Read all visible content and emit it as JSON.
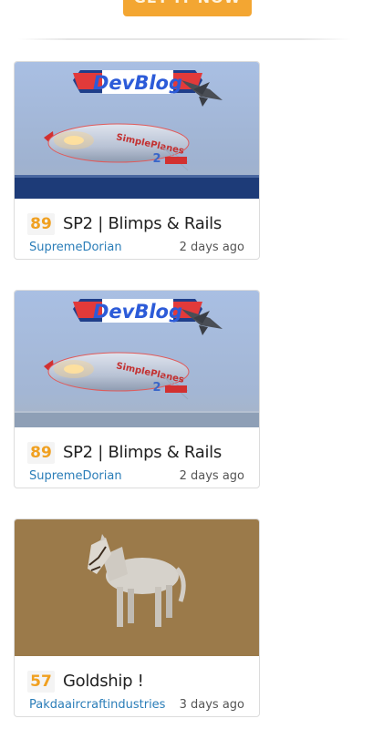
{
  "cta": {
    "label": "GET IT NOW"
  },
  "posts": [
    {
      "score": "89",
      "title": "SP2 | Blimps & Rails",
      "author": "SupremeDorian",
      "age": "2 days ago",
      "thumb": {
        "banner": "DevBlog",
        "blimp_text": "SimplePlanes",
        "blimp_number": "2"
      }
    },
    {
      "score": "89",
      "title": "SP2 | Blimps & Rails",
      "author": "SupremeDorian",
      "age": "2 days ago",
      "thumb": {
        "banner": "DevBlog",
        "blimp_text": "SimplePlanes",
        "blimp_number": "2"
      }
    },
    {
      "score": "57",
      "title": "Goldship !",
      "author": "Pakdaaircraftindustries",
      "age": "3 days ago"
    }
  ]
}
